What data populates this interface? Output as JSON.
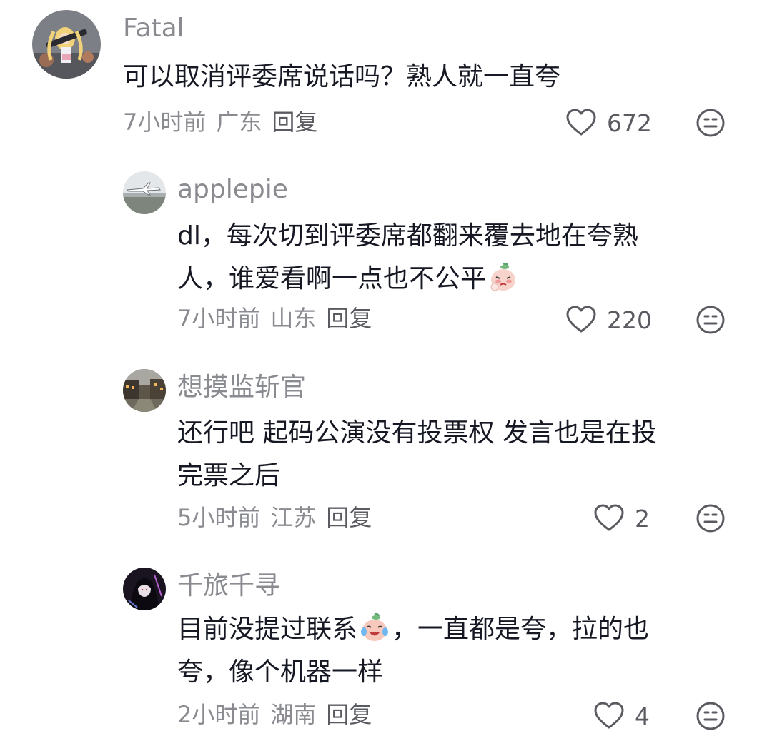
{
  "comments": [
    {
      "username": "Fatal",
      "text": "可以取消评委席说话吗？熟人就一直夸",
      "time": "7小时前",
      "location": "广东",
      "reply": "回复",
      "likes": "672",
      "avatar_icon": "anime-girl-avatar"
    },
    {
      "username": "applepie",
      "text_line1": "dl，每次切到评委席都翻来覆去地在夸熟",
      "text_line2": "人，谁爱看啊一点也不公平",
      "emoji": "crying-peach-emoji",
      "time": "7小时前",
      "location": "山东",
      "reply": "回复",
      "likes": "220",
      "avatar_icon": "airplane-landscape-avatar"
    },
    {
      "username": "想摸监斩官",
      "text_line1": "还行吧 起码公演没有投票权 发言也是在投",
      "text_line2": "完票之后",
      "time": "5小时前",
      "location": "江苏",
      "reply": "回复",
      "likes": "2",
      "avatar_icon": "canal-town-avatar"
    },
    {
      "username": "千旅千寻",
      "text_line1a": "目前没提过联系",
      "text_line1b": "，一直都是夸，拉的也",
      "text_line2": "夸，像个机器一样",
      "emoji": "laughing-tears-peach-emoji",
      "time": "2小时前",
      "location": "湖南",
      "reply": "回复",
      "likes": "4",
      "avatar_icon": "dark-haired-girl-avatar"
    }
  ],
  "colors": {
    "text": "#161823",
    "secondary": "#8a8b91",
    "icon": "#5a5b61"
  }
}
